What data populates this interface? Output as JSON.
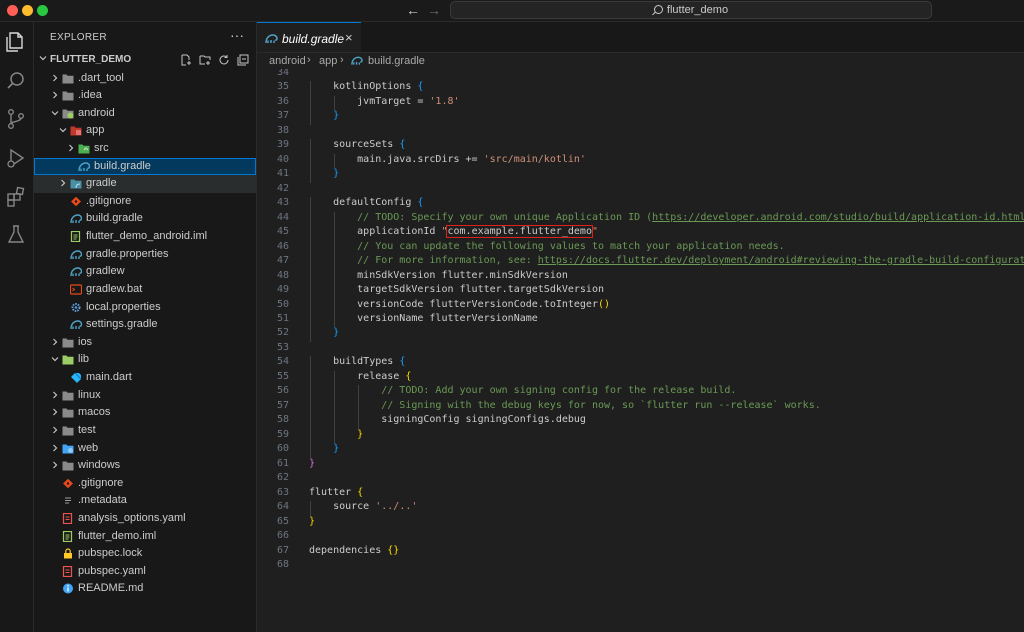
{
  "titlebar": {
    "search_text": "flutter_demo"
  },
  "sidebar": {
    "title": "EXPLORER",
    "more": "···",
    "root": "FLUTTER_DEMO",
    "tree": [
      {
        "label": ".dart_tool",
        "depth": 0,
        "type": "folder",
        "open": false
      },
      {
        "label": ".idea",
        "depth": 0,
        "type": "folder",
        "open": false
      },
      {
        "label": "android",
        "depth": 0,
        "type": "folder-android",
        "open": true
      },
      {
        "label": "app",
        "depth": 1,
        "type": "folder-app",
        "open": true
      },
      {
        "label": "src",
        "depth": 2,
        "type": "folder-src",
        "open": false
      },
      {
        "label": "build.gradle",
        "depth": 2,
        "type": "gradle",
        "selected": true
      },
      {
        "label": "gradle",
        "depth": 1,
        "type": "folder-gradle",
        "open": false,
        "hover": true
      },
      {
        "label": ".gitignore",
        "depth": 1,
        "type": "git"
      },
      {
        "label": "build.gradle",
        "depth": 1,
        "type": "gradle"
      },
      {
        "label": "flutter_demo_android.iml",
        "depth": 1,
        "type": "iml"
      },
      {
        "label": "gradle.properties",
        "depth": 1,
        "type": "gradle"
      },
      {
        "label": "gradlew",
        "depth": 1,
        "type": "gradle"
      },
      {
        "label": "gradlew.bat",
        "depth": 1,
        "type": "bat"
      },
      {
        "label": "local.properties",
        "depth": 1,
        "type": "gear"
      },
      {
        "label": "settings.gradle",
        "depth": 1,
        "type": "gradle"
      },
      {
        "label": "ios",
        "depth": 0,
        "type": "folder",
        "open": false
      },
      {
        "label": "lib",
        "depth": 0,
        "type": "folder-lib",
        "open": true
      },
      {
        "label": "main.dart",
        "depth": 1,
        "type": "dart"
      },
      {
        "label": "linux",
        "depth": 0,
        "type": "folder",
        "open": false
      },
      {
        "label": "macos",
        "depth": 0,
        "type": "folder",
        "open": false
      },
      {
        "label": "test",
        "depth": 0,
        "type": "folder",
        "open": false
      },
      {
        "label": "web",
        "depth": 0,
        "type": "folder-web",
        "open": false
      },
      {
        "label": "windows",
        "depth": 0,
        "type": "folder",
        "open": false
      },
      {
        "label": ".gitignore",
        "depth": 0,
        "type": "git"
      },
      {
        "label": ".metadata",
        "depth": 0,
        "type": "plain"
      },
      {
        "label": "analysis_options.yaml",
        "depth": 0,
        "type": "yaml"
      },
      {
        "label": "flutter_demo.iml",
        "depth": 0,
        "type": "iml"
      },
      {
        "label": "pubspec.lock",
        "depth": 0,
        "type": "lock"
      },
      {
        "label": "pubspec.yaml",
        "depth": 0,
        "type": "yaml"
      },
      {
        "label": "README.md",
        "depth": 0,
        "type": "info"
      }
    ]
  },
  "editor": {
    "tab_label": "build.gradle",
    "tab_close": "×",
    "breadcrumbs": [
      "android",
      "app",
      "build.gradle"
    ],
    "first_line_number": 34,
    "lines": [
      {
        "n": "34",
        "indent": 0,
        "segs": []
      },
      {
        "n": "35",
        "indent": 1,
        "segs": [
          [
            "k",
            "kotlinOptions "
          ],
          [
            "br3",
            "{"
          ]
        ]
      },
      {
        "n": "36",
        "indent": 2,
        "segs": [
          [
            "k",
            "jvmTarget = "
          ],
          [
            "s",
            "'1.8'"
          ]
        ]
      },
      {
        "n": "37",
        "indent": 1,
        "segs": [
          [
            "br3",
            "}"
          ]
        ]
      },
      {
        "n": "38",
        "indent": 0,
        "segs": []
      },
      {
        "n": "39",
        "indent": 1,
        "segs": [
          [
            "k",
            "sourceSets "
          ],
          [
            "br3",
            "{"
          ]
        ]
      },
      {
        "n": "40",
        "indent": 2,
        "segs": [
          [
            "k",
            "main.java.srcDirs += "
          ],
          [
            "s",
            "'src/main/kotlin'"
          ]
        ]
      },
      {
        "n": "41",
        "indent": 1,
        "segs": [
          [
            "br3",
            "}"
          ]
        ]
      },
      {
        "n": "42",
        "indent": 0,
        "segs": []
      },
      {
        "n": "43",
        "indent": 1,
        "segs": [
          [
            "k",
            "defaultConfig "
          ],
          [
            "br3",
            "{"
          ]
        ]
      },
      {
        "n": "44",
        "indent": 2,
        "segs": [
          [
            "c",
            "// TODO: Specify your own unique Application ID ("
          ],
          [
            "u",
            "https://developer.android.com/studio/build/application-id.html"
          ],
          [
            "c",
            ")."
          ]
        ]
      },
      {
        "n": "45",
        "indent": 2,
        "segs": [
          [
            "k",
            "applicationId "
          ],
          [
            "s",
            "\""
          ],
          [
            "hl",
            "com.example.flutter_demo"
          ],
          [
            "s",
            "\""
          ]
        ]
      },
      {
        "n": "46",
        "indent": 2,
        "segs": [
          [
            "c",
            "// You can update the following values to match your application needs."
          ]
        ]
      },
      {
        "n": "47",
        "indent": 2,
        "segs": [
          [
            "c",
            "// For more information, see: "
          ],
          [
            "u",
            "https://docs.flutter.dev/deployment/android#reviewing-the-gradle-build-configuration"
          ],
          [
            "c",
            "."
          ]
        ]
      },
      {
        "n": "48",
        "indent": 2,
        "segs": [
          [
            "k",
            "minSdkVersion flutter.minSdkVersion"
          ]
        ]
      },
      {
        "n": "49",
        "indent": 2,
        "segs": [
          [
            "k",
            "targetSdkVersion flutter.targetSdkVersion"
          ]
        ]
      },
      {
        "n": "50",
        "indent": 2,
        "segs": [
          [
            "k",
            "versionCode flutterVersionCode.toInteger"
          ],
          [
            "br1",
            "()"
          ]
        ]
      },
      {
        "n": "51",
        "indent": 2,
        "segs": [
          [
            "k",
            "versionName flutterVersionName"
          ]
        ]
      },
      {
        "n": "52",
        "indent": 1,
        "segs": [
          [
            "br3",
            "}"
          ]
        ]
      },
      {
        "n": "53",
        "indent": 0,
        "segs": []
      },
      {
        "n": "54",
        "indent": 1,
        "segs": [
          [
            "k",
            "buildTypes "
          ],
          [
            "br3",
            "{"
          ]
        ]
      },
      {
        "n": "55",
        "indent": 2,
        "segs": [
          [
            "k",
            "release "
          ],
          [
            "br1",
            "{"
          ]
        ]
      },
      {
        "n": "56",
        "indent": 3,
        "segs": [
          [
            "c",
            "// TODO: Add your own signing config for the release build."
          ]
        ]
      },
      {
        "n": "57",
        "indent": 3,
        "segs": [
          [
            "c",
            "// Signing with the debug keys for now, so `flutter run --release` works."
          ]
        ]
      },
      {
        "n": "58",
        "indent": 3,
        "segs": [
          [
            "k",
            "signingConfig signingConfigs.debug"
          ]
        ]
      },
      {
        "n": "59",
        "indent": 2,
        "segs": [
          [
            "br1",
            "}"
          ]
        ]
      },
      {
        "n": "60",
        "indent": 1,
        "segs": [
          [
            "br3",
            "}"
          ]
        ]
      },
      {
        "n": "61",
        "indent": 0,
        "segs": [
          [
            "br2",
            "}"
          ]
        ]
      },
      {
        "n": "62",
        "indent": 0,
        "segs": []
      },
      {
        "n": "63",
        "indent": 0,
        "segs": [
          [
            "k",
            "flutter "
          ],
          [
            "br1",
            "{"
          ]
        ]
      },
      {
        "n": "64",
        "indent": 1,
        "segs": [
          [
            "k",
            "source "
          ],
          [
            "s",
            "'../..'"
          ]
        ]
      },
      {
        "n": "65",
        "indent": 0,
        "segs": [
          [
            "br1",
            "}"
          ]
        ]
      },
      {
        "n": "66",
        "indent": 0,
        "segs": []
      },
      {
        "n": "67",
        "indent": 0,
        "segs": [
          [
            "k",
            "dependencies "
          ],
          [
            "br1",
            "{}"
          ]
        ]
      },
      {
        "n": "68",
        "indent": 0,
        "segs": []
      }
    ]
  }
}
